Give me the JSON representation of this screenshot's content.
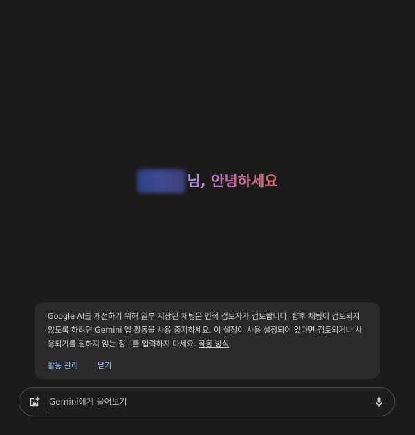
{
  "greeting": {
    "suffix": "님, 안녕하세요"
  },
  "notice": {
    "text": "Google AI를 개선하기 위해 일부 저장된 채팅은 인적 검토자가 검토합니다. 향후 채팅이 검토되지 않도록 하려면 Gemini 앱 활동을 사용 중지하세요. 이 설정이 사용 설정되어 있다면 검토되거나 사용되기를 원하지 않는 정보를 입력하지 마세요.",
    "link_label": "작동 방식",
    "manage_label": "활동 관리",
    "close_label": "닫기"
  },
  "input": {
    "placeholder": "Gemini에게 물어보기"
  },
  "colors": {
    "background": "#1b1b1c",
    "card": "#2a2a2c",
    "action": "#9ec2ff"
  },
  "icons": {
    "image_upload": "image-add-icon",
    "microphone": "microphone-icon"
  }
}
